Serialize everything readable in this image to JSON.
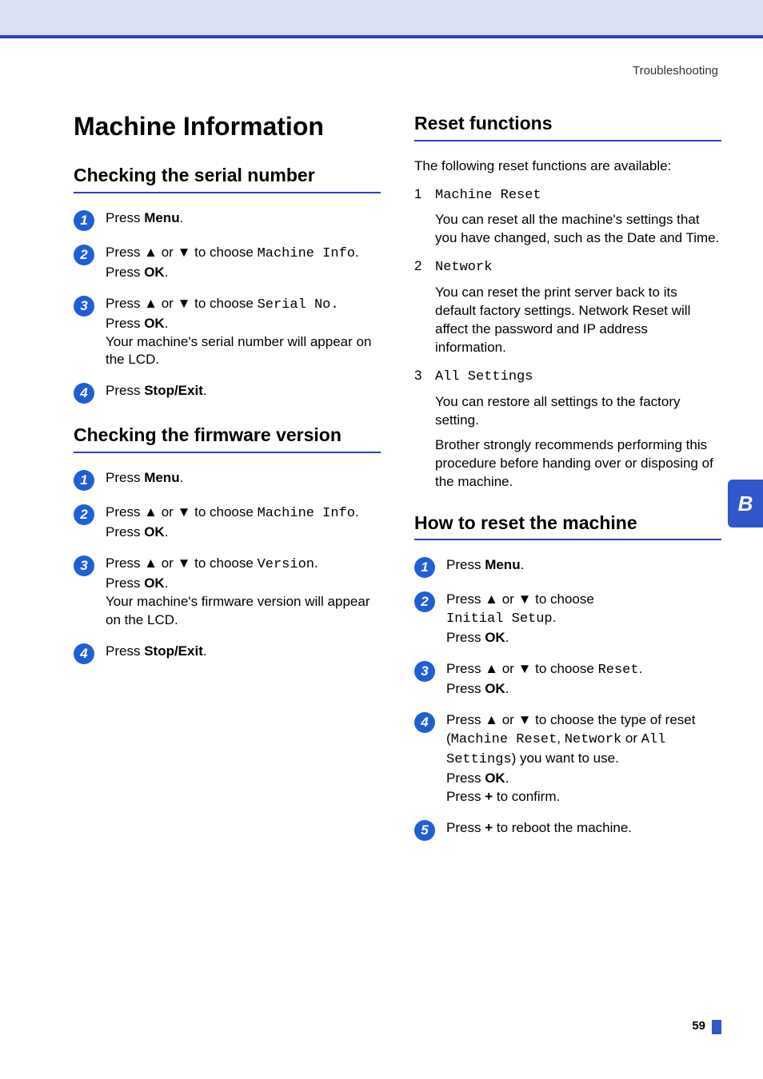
{
  "breadcrumb": "Troubleshooting",
  "side_tab": "B",
  "page_number": "59",
  "left": {
    "h1": "Machine Information",
    "section1": {
      "title": "Checking the serial number",
      "steps": [
        {
          "n": "1",
          "segs": [
            {
              "t": "Press "
            },
            {
              "t": "Menu",
              "b": true
            },
            {
              "t": "."
            }
          ]
        },
        {
          "n": "2",
          "lines": [
            {
              "segs": [
                {
                  "t": "Press ▲ or ▼ to choose "
                },
                {
                  "t": "Machine Info",
                  "m": true
                },
                {
                  "t": "."
                }
              ]
            },
            {
              "segs": [
                {
                  "t": "Press "
                },
                {
                  "t": "OK",
                  "b": true
                },
                {
                  "t": "."
                }
              ]
            }
          ]
        },
        {
          "n": "3",
          "lines": [
            {
              "segs": [
                {
                  "t": "Press ▲ or ▼ to choose "
                },
                {
                  "t": "Serial No.",
                  "m": true
                }
              ]
            },
            {
              "segs": [
                {
                  "t": "Press "
                },
                {
                  "t": "OK",
                  "b": true
                },
                {
                  "t": "."
                }
              ]
            },
            {
              "segs": [
                {
                  "t": "Your machine's serial number will appear on the LCD."
                }
              ]
            }
          ]
        },
        {
          "n": "4",
          "segs": [
            {
              "t": "Press "
            },
            {
              "t": "Stop/Exit",
              "b": true
            },
            {
              "t": "."
            }
          ]
        }
      ]
    },
    "section2": {
      "title": "Checking the firmware version",
      "steps": [
        {
          "n": "1",
          "segs": [
            {
              "t": "Press "
            },
            {
              "t": "Menu",
              "b": true
            },
            {
              "t": "."
            }
          ]
        },
        {
          "n": "2",
          "lines": [
            {
              "segs": [
                {
                  "t": "Press ▲ or ▼ to choose "
                },
                {
                  "t": "Machine Info",
                  "m": true
                },
                {
                  "t": "."
                }
              ]
            },
            {
              "segs": [
                {
                  "t": "Press "
                },
                {
                  "t": "OK",
                  "b": true
                },
                {
                  "t": "."
                }
              ]
            }
          ]
        },
        {
          "n": "3",
          "lines": [
            {
              "segs": [
                {
                  "t": "Press ▲ or ▼ to choose "
                },
                {
                  "t": "Version",
                  "m": true
                },
                {
                  "t": "."
                }
              ]
            },
            {
              "segs": [
                {
                  "t": "Press "
                },
                {
                  "t": "OK",
                  "b": true
                },
                {
                  "t": "."
                }
              ]
            },
            {
              "segs": [
                {
                  "t": "Your machine's firmware version will appear on the LCD."
                }
              ]
            }
          ]
        },
        {
          "n": "4",
          "segs": [
            {
              "t": "Press "
            },
            {
              "t": "Stop/Exit",
              "b": true
            },
            {
              "t": "."
            }
          ]
        }
      ]
    }
  },
  "right": {
    "section1": {
      "title": "Reset functions",
      "intro": "The following reset functions are available:",
      "items": [
        {
          "head_mono": "Machine Reset",
          "desc_segs": [
            {
              "t": "You can reset all the machine's settings that you have changed, such as the Date and Time."
            }
          ]
        },
        {
          "head_mono": "Network",
          "desc_segs": [
            {
              "t": "You can reset the print server back to its default factory settings. Network Reset will affect the password and IP address information."
            }
          ]
        },
        {
          "head_mono": "All Settings",
          "desc_lines": [
            {
              "segs": [
                {
                  "t": "You can restore all settings to the factory setting."
                }
              ]
            },
            {
              "segs": [
                {
                  "t": "Brother strongly recommends performing this procedure before handing over or disposing of the machine."
                }
              ]
            }
          ]
        }
      ]
    },
    "section2": {
      "title": "How to reset the machine",
      "steps": [
        {
          "n": "1",
          "segs": [
            {
              "t": "Press "
            },
            {
              "t": "Menu",
              "b": true
            },
            {
              "t": "."
            }
          ]
        },
        {
          "n": "2",
          "lines": [
            {
              "segs": [
                {
                  "t": "Press ▲ or ▼ to choose"
                }
              ]
            },
            {
              "segs": [
                {
                  "t": "Initial Setup",
                  "m": true
                },
                {
                  "t": "."
                }
              ]
            },
            {
              "segs": [
                {
                  "t": "Press "
                },
                {
                  "t": "OK",
                  "b": true
                },
                {
                  "t": "."
                }
              ]
            }
          ]
        },
        {
          "n": "3",
          "lines": [
            {
              "segs": [
                {
                  "t": "Press ▲ or ▼ to choose "
                },
                {
                  "t": "Reset",
                  "m": true
                },
                {
                  "t": "."
                }
              ]
            },
            {
              "segs": [
                {
                  "t": "Press "
                },
                {
                  "t": "OK",
                  "b": true
                },
                {
                  "t": "."
                }
              ]
            }
          ]
        },
        {
          "n": "4",
          "lines": [
            {
              "segs": [
                {
                  "t": "Press ▲ or ▼ to choose the type of reset ("
                },
                {
                  "t": "Machine Reset",
                  "m": true
                },
                {
                  "t": ", "
                },
                {
                  "t": "Network",
                  "m": true
                },
                {
                  "t": " or "
                },
                {
                  "t": "All Settings",
                  "m": true
                },
                {
                  "t": ") you want to use."
                }
              ]
            },
            {
              "segs": [
                {
                  "t": "Press "
                },
                {
                  "t": "OK",
                  "b": true
                },
                {
                  "t": "."
                }
              ]
            },
            {
              "segs": [
                {
                  "t": "Press "
                },
                {
                  "t": "+",
                  "b": true
                },
                {
                  "t": " to confirm."
                }
              ]
            }
          ]
        },
        {
          "n": "5",
          "segs": [
            {
              "t": "Press "
            },
            {
              "t": "+",
              "b": true
            },
            {
              "t": " to reboot the machine."
            }
          ]
        }
      ]
    }
  }
}
